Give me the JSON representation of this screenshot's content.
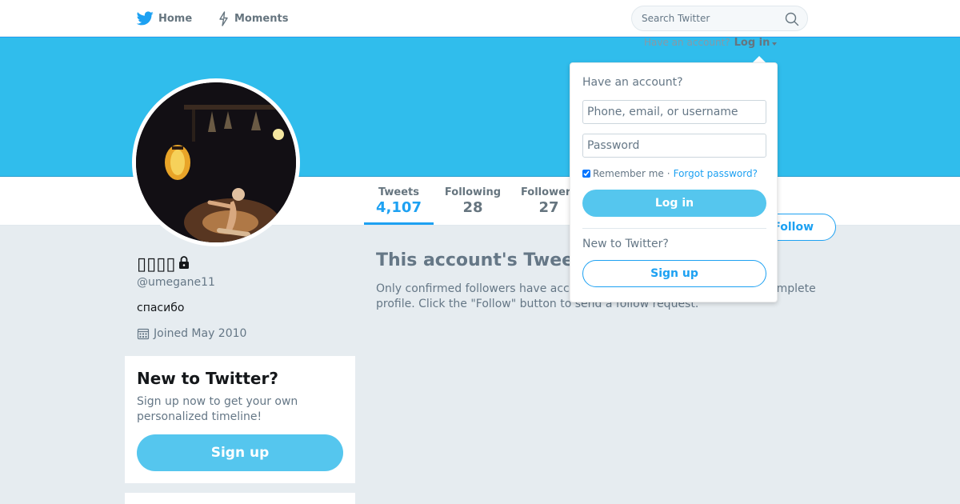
{
  "nav": {
    "home_label": "Home",
    "moments_label": "Moments",
    "search_placeholder": "Search Twitter",
    "have_account": "Have an account?",
    "login_link": "Log in"
  },
  "icons": {
    "home": "twitter-bird-icon",
    "moments": "lightning-icon",
    "search": "search-icon",
    "lock": "lock-icon",
    "calendar": "calendar-icon"
  },
  "colors": {
    "banner": "#30bdec",
    "accent": "#1da1f2",
    "button_fill": "#55c6ee",
    "page_bg": "#e6ecf0"
  },
  "profile": {
    "display_name": "▯▯▯▯",
    "handle": "@umegane11",
    "bio": "спасибо",
    "joined": "Joined May 2010",
    "protected": true
  },
  "stats": [
    {
      "label": "Tweets",
      "value": "4,107",
      "active": true
    },
    {
      "label": "Following",
      "value": "28",
      "active": false
    },
    {
      "label": "Followers",
      "value": "27",
      "active": false
    }
  ],
  "follow_button": "Follow",
  "protected": {
    "title": "This account's Tweets are protected.",
    "text": "Only confirmed followers have access to @umegane11's Tweets and complete profile. Click the \"Follow\" button to send a follow request."
  },
  "signup_module": {
    "title": "New to Twitter?",
    "text": "Sign up now to get your own personalized timeline!",
    "button": "Sign up"
  },
  "login_dropdown": {
    "heading": "Have an account?",
    "username_placeholder": "Phone, email, or username",
    "password_placeholder": "Password",
    "remember_label": "Remember me",
    "separator": "·",
    "forgot_label": "Forgot password?",
    "remember_checked": true,
    "login_button": "Log in",
    "new_heading": "New to Twitter?",
    "signup_button": "Sign up"
  }
}
